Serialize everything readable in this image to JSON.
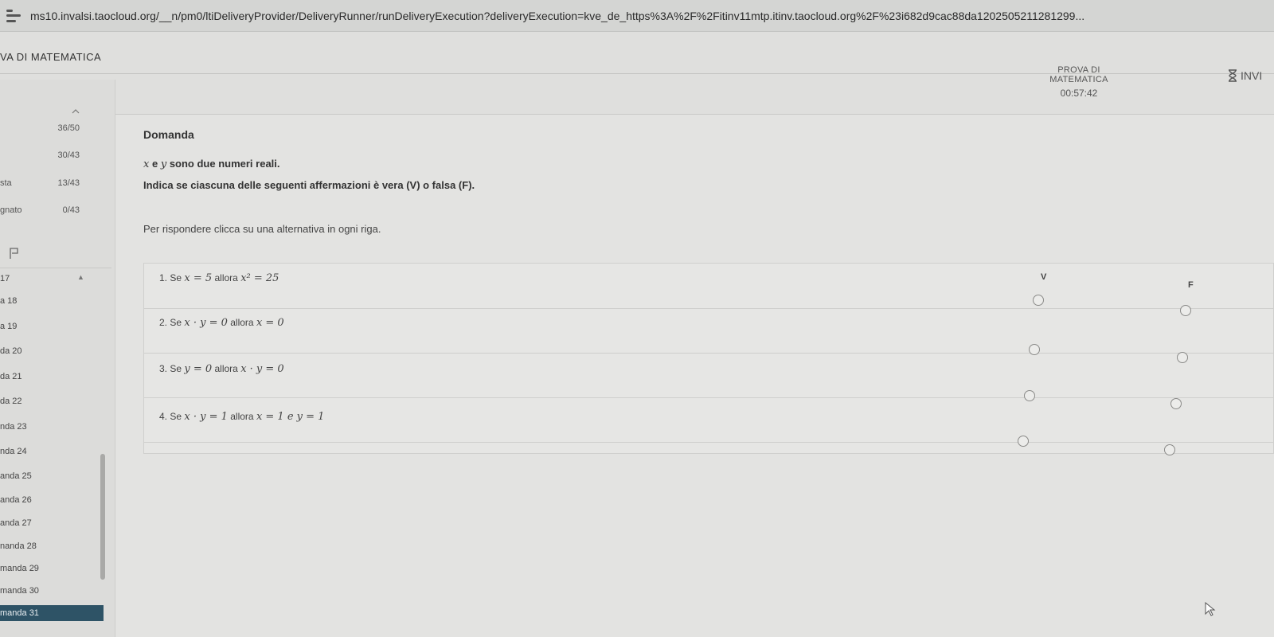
{
  "browser": {
    "url": "ms10.invalsi.taocloud.org/__n/pm0/ltiDeliveryProvider/DeliveryRunner/runDeliveryExecution?deliveryExecution=kve_de_https%3A%2F%2Fitinv11mtp.itinv.taocloud.org%2F%23i682d9cac88da1202505211281299..."
  },
  "header": {
    "test_title": "VA DI MATEMATICA",
    "prova_label": "PROVA DI MATEMATICA",
    "timer": "00:57:42",
    "invia_label": "INVI"
  },
  "sidebar": {
    "stats": [
      {
        "label": "",
        "value": "36/50"
      },
      {
        "label": "",
        "value": "30/43"
      },
      {
        "label": "sta",
        "value": "13/43"
      },
      {
        "label": "gnato",
        "value": "0/43"
      }
    ],
    "questions": [
      {
        "label": "17"
      },
      {
        "label": "a 18"
      },
      {
        "label": "a 19"
      },
      {
        "label": "da 20"
      },
      {
        "label": "da 21"
      },
      {
        "label": "da 22"
      },
      {
        "label": "nda 23"
      },
      {
        "label": "nda 24"
      },
      {
        "label": "anda 25"
      },
      {
        "label": "anda 26"
      },
      {
        "label": "anda 27"
      },
      {
        "label": "nanda 28"
      },
      {
        "label": "manda 29"
      },
      {
        "label": "manda 30"
      },
      {
        "label": "manda 31"
      }
    ]
  },
  "question": {
    "heading": "Domanda",
    "prompt_conn": "e",
    "prompt_rest": "sono due numeri reali.",
    "instruction": "Indica se ciascuna delle seguenti affermazioni è vera (V) o falsa (F).",
    "hint": "Per rispondere clicca su una alternativa in ogni riga.",
    "col_true": "V",
    "col_false": "F",
    "rows": [
      {
        "num": "1. Se",
        "cond": "x = 5",
        "allora": "allora",
        "concl": "x² = 25"
      },
      {
        "num": "2. Se",
        "cond": "x · y = 0",
        "allora": "allora",
        "concl": "x = 0"
      },
      {
        "num": "3. Se",
        "cond": "y = 0",
        "allora": "allora",
        "concl": "x · y = 0"
      },
      {
        "num": "4. Se",
        "cond": "x · y = 1",
        "allora": "allora",
        "concl": "x = 1 e y = 1"
      }
    ]
  },
  "icons": {
    "address": "tab-strip-icon",
    "send": "hourglass-icon",
    "flag": "flag-icon",
    "pointer": "mouse-cursor-icon"
  }
}
